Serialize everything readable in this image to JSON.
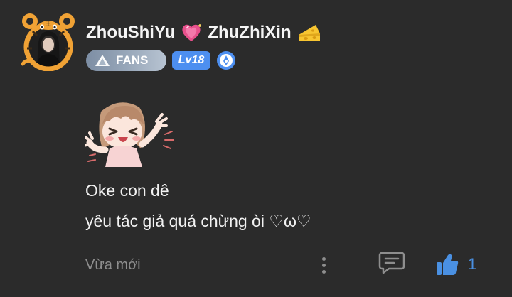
{
  "comment": {
    "author": {
      "name_part1": "ZhouShiYu",
      "name_part2": "ZhuZhiXin",
      "heart_emoji_icon": "sparkling-heart-icon",
      "cheese_emoji_icon": "cheese-icon",
      "avatar_frame": "tiger-frame",
      "fans_badge": "FANS",
      "level_badge": "Lv18",
      "medal_icon": "medal-icon"
    },
    "sticker": "anime-girl-sticker",
    "message_lines": [
      "Oke con dê",
      "yêu tác giả quá chừng òi ♡ω♡"
    ],
    "timestamp": "Vừa mới",
    "like_count": "1"
  },
  "colors": {
    "background": "#2b2b2b",
    "text": "#f2f2f2",
    "muted": "#8e8e8e",
    "accent": "#4a90e2",
    "level_badge": "#4d8ff0"
  }
}
